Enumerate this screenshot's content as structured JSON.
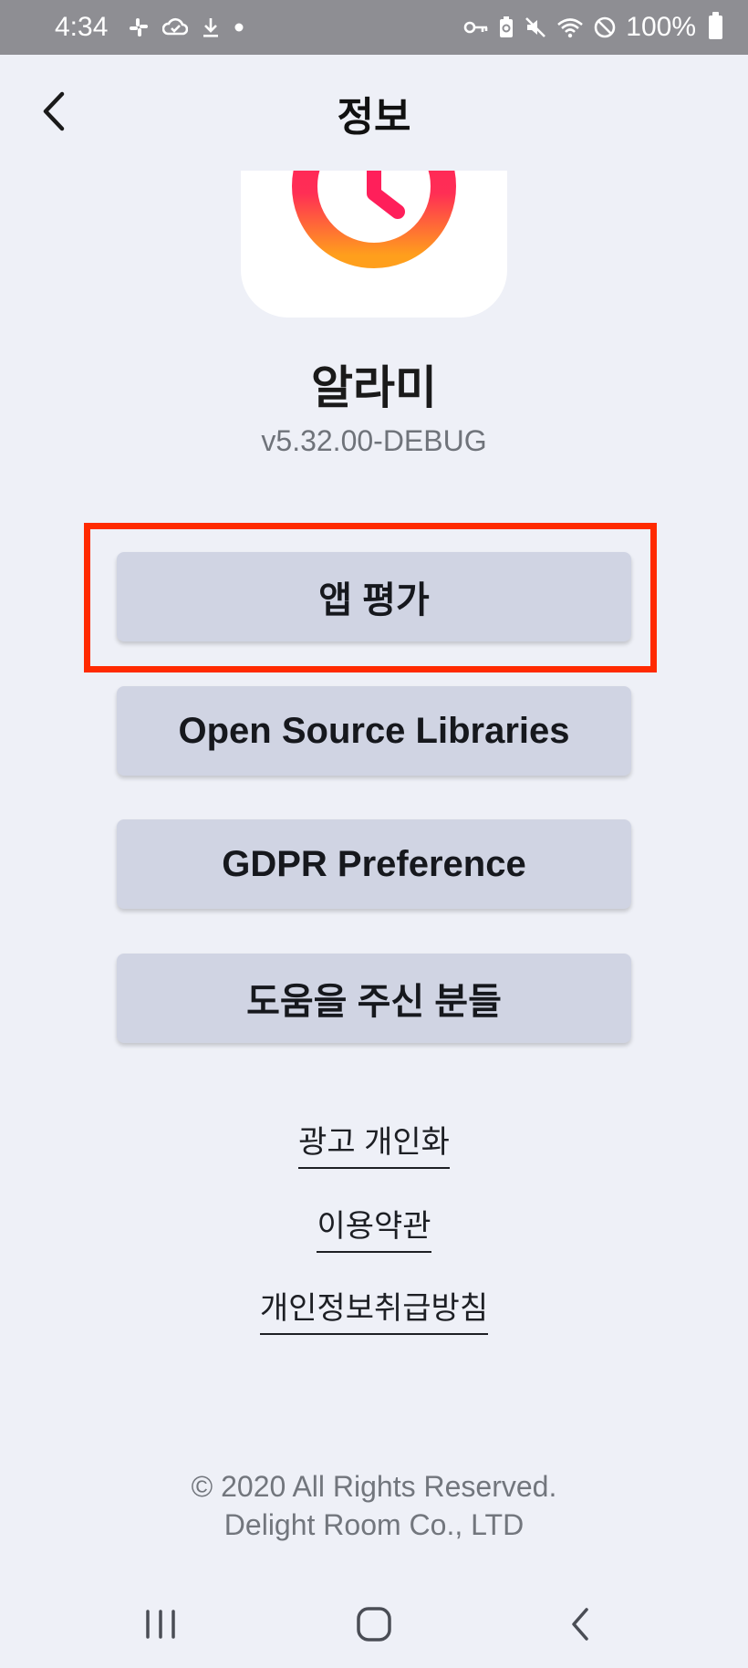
{
  "status_bar": {
    "time": "4:34",
    "left_icons": [
      "slack-icon",
      "cloud-check-icon",
      "download-icon",
      "dot-icon"
    ],
    "right_icons": [
      "key-icon",
      "battery-saver-icon",
      "mute-icon",
      "wifi-icon",
      "do-not-disturb-icon",
      "battery-icon"
    ],
    "battery_text": "100%"
  },
  "app_bar": {
    "title": "정보",
    "back_icon": "chevron-left-icon"
  },
  "app": {
    "name": "알라미",
    "version": "v5.32.00-DEBUG",
    "icon": "alarm-clock-icon",
    "icon_gradient": [
      "#ff1f5a",
      "#ff9f1c"
    ]
  },
  "buttons": {
    "rate": "앱 평가",
    "oss": "Open Source Libraries",
    "gdpr": "GDPR Preference",
    "thanks": "도움을 주신 분들"
  },
  "links": {
    "ads": "광고 개인화",
    "terms": "이용약관",
    "privacy": "개인정보취급방침"
  },
  "footer": {
    "line1": "© 2020 All Rights Reserved.",
    "line2": "Delight Room Co., LTD"
  },
  "colors": {
    "background": "#eef0f7",
    "button": "#d0d4e3",
    "highlight": "#ff2a00",
    "status_bar": "#8e8e93"
  },
  "nav_bar": {
    "icons": [
      "recents-icon",
      "home-icon",
      "back-icon"
    ]
  }
}
